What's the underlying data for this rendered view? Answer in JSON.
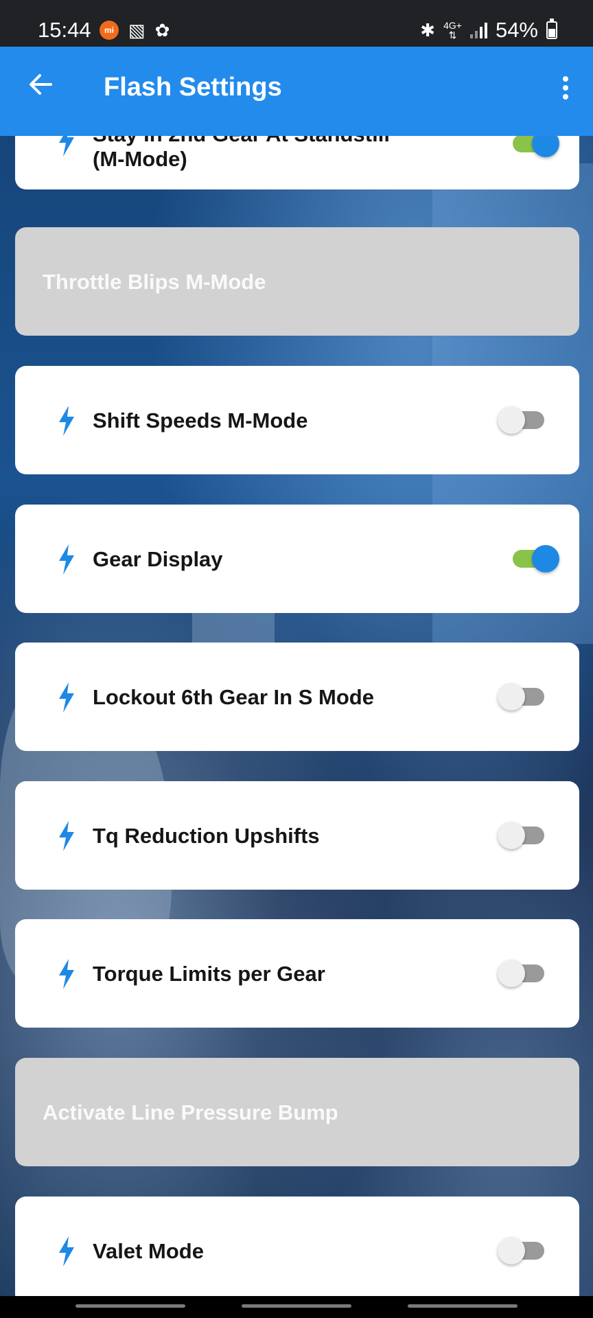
{
  "status_bar": {
    "time": "15:44",
    "network": "4G+",
    "battery_percent": "54%",
    "left_icons": [
      "xiaomi-icon",
      "gallery-icon",
      "fan-icon"
    ],
    "right_icons": [
      "bluetooth-icon",
      "network-icon",
      "signal-icon",
      "battery-icon"
    ]
  },
  "app_bar": {
    "title": "Flash Settings",
    "back_icon": "arrow-left-icon",
    "menu_icon": "more-vert-icon"
  },
  "colors": {
    "accent": "#238bec",
    "toggle_on_track": "#8bc34a",
    "toggle_on_knob": "#1e88e5",
    "section_bg": "#d2d2d2"
  },
  "list": {
    "partial_item": {
      "label_line1": "Stay In 2nd Gear At Standstill",
      "label_line2": "(M-Mode)",
      "enabled": true
    },
    "section_throttle": {
      "label": "Throttle Blips M-Mode"
    },
    "shift_speeds": {
      "label": "Shift Speeds M-Mode",
      "enabled": false
    },
    "gear_display": {
      "label": "Gear Display",
      "enabled": true
    },
    "lockout_6th": {
      "label": "Lockout 6th Gear In S Mode",
      "enabled": false
    },
    "tq_reduction": {
      "label": "Tq Reduction Upshifts",
      "enabled": false
    },
    "torque_limits": {
      "label": "Torque Limits per Gear",
      "enabled": false
    },
    "section_line_pressure": {
      "label": "Activate Line Pressure Bump"
    },
    "valet_mode": {
      "label": "Valet Mode",
      "enabled": false
    }
  }
}
